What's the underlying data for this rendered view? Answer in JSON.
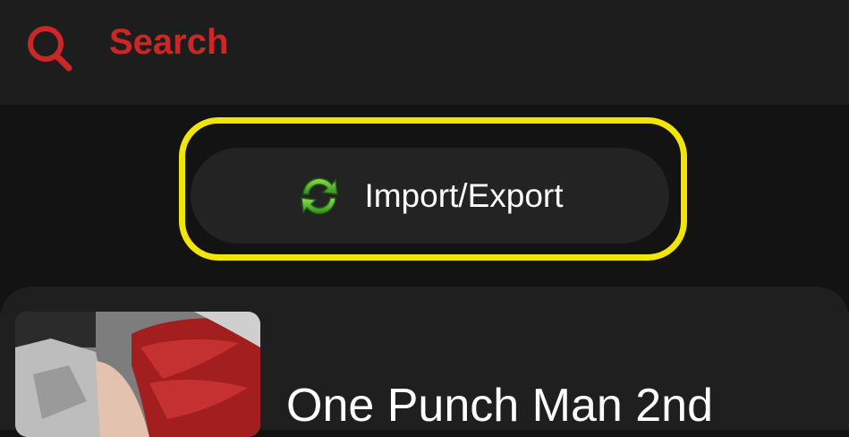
{
  "search": {
    "icon": "search-icon",
    "label": "Search",
    "accent_color": "#cc2727"
  },
  "import_export": {
    "icon": "sync-icon",
    "label": "Import/Export",
    "highlight_color": "#f2e600"
  },
  "manga_card": {
    "title": "One Punch Man 2nd",
    "cover": "one-punch-man-cover"
  }
}
